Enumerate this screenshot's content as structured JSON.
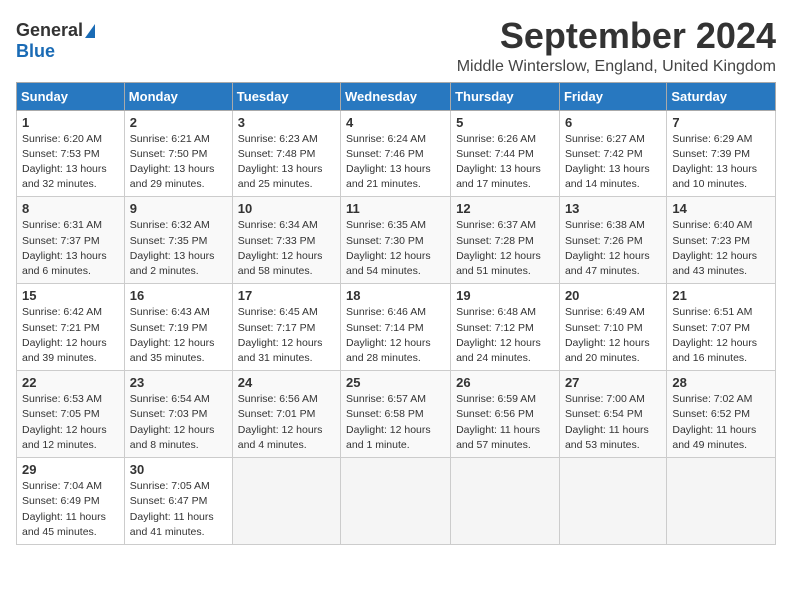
{
  "logo": {
    "line1": "General",
    "line2": "Blue"
  },
  "title": "September 2024",
  "location": "Middle Winterslow, England, United Kingdom",
  "days_of_week": [
    "Sunday",
    "Monday",
    "Tuesday",
    "Wednesday",
    "Thursday",
    "Friday",
    "Saturday"
  ],
  "weeks": [
    [
      {
        "num": "1",
        "lines": [
          "Sunrise: 6:20 AM",
          "Sunset: 7:53 PM",
          "Daylight: 13 hours",
          "and 32 minutes."
        ]
      },
      {
        "num": "2",
        "lines": [
          "Sunrise: 6:21 AM",
          "Sunset: 7:50 PM",
          "Daylight: 13 hours",
          "and 29 minutes."
        ]
      },
      {
        "num": "3",
        "lines": [
          "Sunrise: 6:23 AM",
          "Sunset: 7:48 PM",
          "Daylight: 13 hours",
          "and 25 minutes."
        ]
      },
      {
        "num": "4",
        "lines": [
          "Sunrise: 6:24 AM",
          "Sunset: 7:46 PM",
          "Daylight: 13 hours",
          "and 21 minutes."
        ]
      },
      {
        "num": "5",
        "lines": [
          "Sunrise: 6:26 AM",
          "Sunset: 7:44 PM",
          "Daylight: 13 hours",
          "and 17 minutes."
        ]
      },
      {
        "num": "6",
        "lines": [
          "Sunrise: 6:27 AM",
          "Sunset: 7:42 PM",
          "Daylight: 13 hours",
          "and 14 minutes."
        ]
      },
      {
        "num": "7",
        "lines": [
          "Sunrise: 6:29 AM",
          "Sunset: 7:39 PM",
          "Daylight: 13 hours",
          "and 10 minutes."
        ]
      }
    ],
    [
      {
        "num": "8",
        "lines": [
          "Sunrise: 6:31 AM",
          "Sunset: 7:37 PM",
          "Daylight: 13 hours",
          "and 6 minutes."
        ]
      },
      {
        "num": "9",
        "lines": [
          "Sunrise: 6:32 AM",
          "Sunset: 7:35 PM",
          "Daylight: 13 hours",
          "and 2 minutes."
        ]
      },
      {
        "num": "10",
        "lines": [
          "Sunrise: 6:34 AM",
          "Sunset: 7:33 PM",
          "Daylight: 12 hours",
          "and 58 minutes."
        ]
      },
      {
        "num": "11",
        "lines": [
          "Sunrise: 6:35 AM",
          "Sunset: 7:30 PM",
          "Daylight: 12 hours",
          "and 54 minutes."
        ]
      },
      {
        "num": "12",
        "lines": [
          "Sunrise: 6:37 AM",
          "Sunset: 7:28 PM",
          "Daylight: 12 hours",
          "and 51 minutes."
        ]
      },
      {
        "num": "13",
        "lines": [
          "Sunrise: 6:38 AM",
          "Sunset: 7:26 PM",
          "Daylight: 12 hours",
          "and 47 minutes."
        ]
      },
      {
        "num": "14",
        "lines": [
          "Sunrise: 6:40 AM",
          "Sunset: 7:23 PM",
          "Daylight: 12 hours",
          "and 43 minutes."
        ]
      }
    ],
    [
      {
        "num": "15",
        "lines": [
          "Sunrise: 6:42 AM",
          "Sunset: 7:21 PM",
          "Daylight: 12 hours",
          "and 39 minutes."
        ]
      },
      {
        "num": "16",
        "lines": [
          "Sunrise: 6:43 AM",
          "Sunset: 7:19 PM",
          "Daylight: 12 hours",
          "and 35 minutes."
        ]
      },
      {
        "num": "17",
        "lines": [
          "Sunrise: 6:45 AM",
          "Sunset: 7:17 PM",
          "Daylight: 12 hours",
          "and 31 minutes."
        ]
      },
      {
        "num": "18",
        "lines": [
          "Sunrise: 6:46 AM",
          "Sunset: 7:14 PM",
          "Daylight: 12 hours",
          "and 28 minutes."
        ]
      },
      {
        "num": "19",
        "lines": [
          "Sunrise: 6:48 AM",
          "Sunset: 7:12 PM",
          "Daylight: 12 hours",
          "and 24 minutes."
        ]
      },
      {
        "num": "20",
        "lines": [
          "Sunrise: 6:49 AM",
          "Sunset: 7:10 PM",
          "Daylight: 12 hours",
          "and 20 minutes."
        ]
      },
      {
        "num": "21",
        "lines": [
          "Sunrise: 6:51 AM",
          "Sunset: 7:07 PM",
          "Daylight: 12 hours",
          "and 16 minutes."
        ]
      }
    ],
    [
      {
        "num": "22",
        "lines": [
          "Sunrise: 6:53 AM",
          "Sunset: 7:05 PM",
          "Daylight: 12 hours",
          "and 12 minutes."
        ]
      },
      {
        "num": "23",
        "lines": [
          "Sunrise: 6:54 AM",
          "Sunset: 7:03 PM",
          "Daylight: 12 hours",
          "and 8 minutes."
        ]
      },
      {
        "num": "24",
        "lines": [
          "Sunrise: 6:56 AM",
          "Sunset: 7:01 PM",
          "Daylight: 12 hours",
          "and 4 minutes."
        ]
      },
      {
        "num": "25",
        "lines": [
          "Sunrise: 6:57 AM",
          "Sunset: 6:58 PM",
          "Daylight: 12 hours",
          "and 1 minute."
        ]
      },
      {
        "num": "26",
        "lines": [
          "Sunrise: 6:59 AM",
          "Sunset: 6:56 PM",
          "Daylight: 11 hours",
          "and 57 minutes."
        ]
      },
      {
        "num": "27",
        "lines": [
          "Sunrise: 7:00 AM",
          "Sunset: 6:54 PM",
          "Daylight: 11 hours",
          "and 53 minutes."
        ]
      },
      {
        "num": "28",
        "lines": [
          "Sunrise: 7:02 AM",
          "Sunset: 6:52 PM",
          "Daylight: 11 hours",
          "and 49 minutes."
        ]
      }
    ],
    [
      {
        "num": "29",
        "lines": [
          "Sunrise: 7:04 AM",
          "Sunset: 6:49 PM",
          "Daylight: 11 hours",
          "and 45 minutes."
        ]
      },
      {
        "num": "30",
        "lines": [
          "Sunrise: 7:05 AM",
          "Sunset: 6:47 PM",
          "Daylight: 11 hours",
          "and 41 minutes."
        ]
      },
      null,
      null,
      null,
      null,
      null
    ]
  ]
}
